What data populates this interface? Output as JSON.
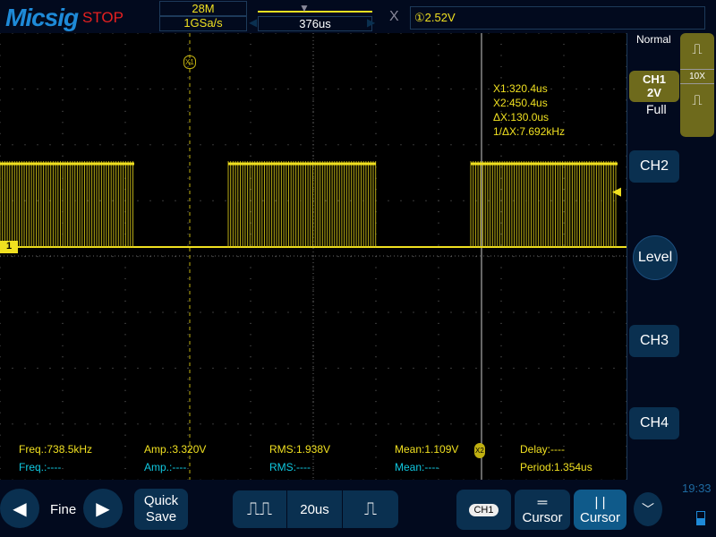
{
  "header": {
    "brand": "Micsig",
    "status": "STOP",
    "memory": "28M",
    "sample_rate": "1GSa/s",
    "time_position": "376us",
    "trigger_icon": "trigger-x-icon",
    "trigger_level": "①2.52V"
  },
  "screen": {
    "channel_marker": "1",
    "cursor_x1_label": "X1",
    "cursor_x2_label": "X2",
    "cursor_readout": [
      "X1:320.4us",
      "X2:450.4us",
      "ΔX:130.0us",
      "1/ΔX:7.692kHz"
    ],
    "measurements_ch1": [
      {
        "label": "Freq.:738.5kHz"
      },
      {
        "label": "Amp.:3.320V"
      },
      {
        "label": "RMS:1.938V"
      },
      {
        "label": "Mean:1.109V"
      },
      {
        "label": "Delay:----"
      }
    ],
    "measurements_ch2": [
      {
        "label": "Freq.:----"
      },
      {
        "label": "Amp.:----"
      },
      {
        "label": "RMS:----"
      },
      {
        "label": "Mean:----"
      },
      {
        "label": "Period:1.354us"
      }
    ],
    "colors": {
      "ch1": "#f0e020",
      "ch2_meas": "#10c8e0"
    }
  },
  "side": {
    "trigger_mode": "Normal",
    "ch1_label": "CH1",
    "ch1_scale": "2V",
    "ch1_bw": "Full",
    "probe": "10X",
    "ch2": "CH2",
    "level": "Level",
    "ch3": "CH3",
    "ch4": "CH4"
  },
  "bottom": {
    "fine": "Fine",
    "quick": "Quick",
    "save": "Save",
    "timebase": "20us",
    "ch1_chip": "CH1",
    "cursor_h": "Cursor",
    "cursor_v": "Cursor",
    "clock": "19:33"
  }
}
